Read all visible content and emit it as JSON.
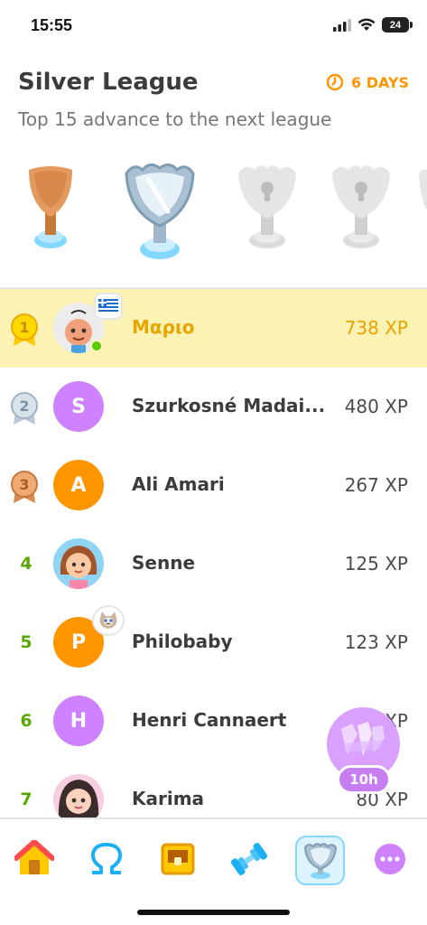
{
  "status_bar": {
    "time": "15:55",
    "battery": "24"
  },
  "header": {
    "league_title": "Silver League",
    "days_left": "6 DAYS",
    "subtitle": "Top 15 advance to the next league"
  },
  "trophies": [
    {
      "name": "bronze",
      "state": "passed"
    },
    {
      "name": "silver",
      "state": "current"
    },
    {
      "name": "gold",
      "state": "locked"
    },
    {
      "name": "sapphire",
      "state": "locked"
    }
  ],
  "leaderboard": [
    {
      "rank": "1",
      "name": "Μαριο",
      "xp": "738 XP",
      "initial": "",
      "is_me": true
    },
    {
      "rank": "2",
      "name": "Szurkosné Madai...",
      "xp": "480 XP",
      "initial": "S"
    },
    {
      "rank": "3",
      "name": "Ali Amari",
      "xp": "267 XP",
      "initial": "A"
    },
    {
      "rank": "4",
      "name": "Senne",
      "xp": "125 XP",
      "initial": ""
    },
    {
      "rank": "5",
      "name": "Philobaby",
      "xp": "123 XP",
      "initial": "P"
    },
    {
      "rank": "6",
      "name": "Henri Cannaert",
      "xp": "XP",
      "initial": "H"
    },
    {
      "rank": "7",
      "name": "Karima",
      "xp": "80 XP",
      "initial": ""
    }
  ],
  "chest": {
    "timer": "10h"
  },
  "nav": [
    "home-tab",
    "characters-tab",
    "quests-tab",
    "practice-tab",
    "leagues-tab",
    "more-tab"
  ],
  "colors": {
    "accent_orange": "#ff9600",
    "gold_highlight": "#fcf2b3",
    "green": "#58a700",
    "purple": "#ce82ff"
  }
}
